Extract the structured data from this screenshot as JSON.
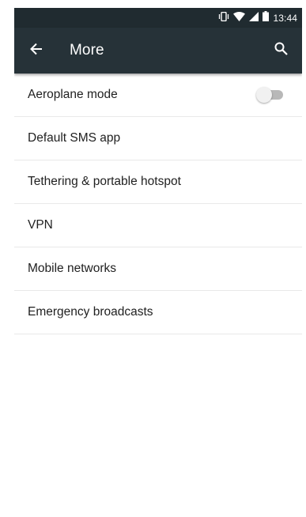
{
  "status_bar": {
    "time": "13:44",
    "icons": [
      "vibrate-icon",
      "wifi-icon",
      "signal-icon",
      "battery-icon"
    ]
  },
  "app_bar": {
    "title": "More",
    "back_icon": "arrow-left-icon",
    "search_icon": "search-icon"
  },
  "settings": [
    {
      "label": "Aeroplane mode",
      "has_toggle": true,
      "toggle_on": false
    },
    {
      "label": "Default SMS app"
    },
    {
      "label": "Tethering & portable hotspot"
    },
    {
      "label": "VPN"
    },
    {
      "label": "Mobile networks"
    },
    {
      "label": "Emergency broadcasts"
    }
  ],
  "colors": {
    "status_bar": "#202b30",
    "app_bar": "#263238",
    "text": "#212121",
    "divider": "#e9e9e9"
  }
}
